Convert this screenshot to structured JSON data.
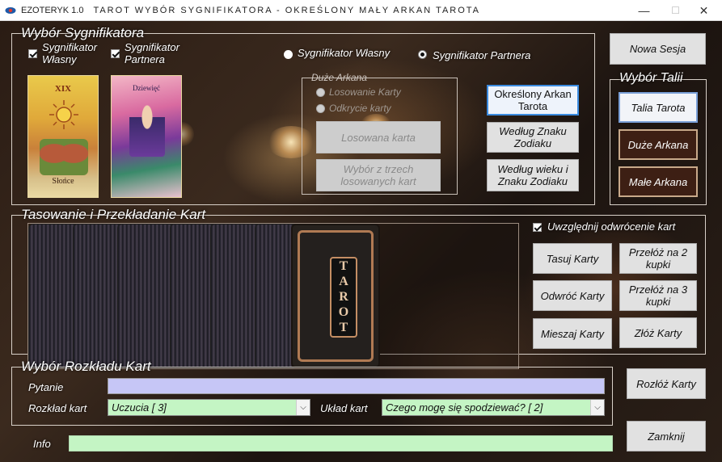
{
  "window": {
    "version": "EZOTERYK 1.0",
    "title": "TAROT   WYBÓR SYGNIFIKATORA - OKREŚLONY MAŁY ARKAN TAROTA",
    "minimize": "—",
    "maximize": "☐",
    "close": "✕"
  },
  "significator": {
    "group_title": "Wybór Sygnifikatora",
    "own_checkbox": "Sygnifikator Własny",
    "partner_checkbox": "Sygnifikator Partnera",
    "radio_own": "Sygnifikator Własny",
    "radio_partner": "Sygnifikator Partnera",
    "selected_radio": "partner",
    "card_own_numeral": "XIX",
    "card_own_caption": "Słońce",
    "card_partner_caption": "Dziewięć"
  },
  "major_arcana": {
    "group_title": "Duże Arkana",
    "radio_draw": "Losowanie Karty",
    "radio_pull": "Odkrycie karty",
    "random_card_button": "Losowana karta",
    "choose_three_button": "Wybór z trzech losowanych kart"
  },
  "significator_mode_buttons": {
    "specific_minor": "Określony Arkan Tarota",
    "by_zodiac": "Według Znaku Zodiaku",
    "by_age_zodiac": "Według wieku i Znaku Zodiaku"
  },
  "session": {
    "new_session_button": "Nowa Sesja"
  },
  "deck_choice": {
    "group_title": "Wybór Talii",
    "tarot_deck_button": "Talia Tarota",
    "major_button": "Duże Arkana",
    "minor_button": "Małe Arkana"
  },
  "shuffle": {
    "group_title": "Tasowanie i Przekładanie Kart",
    "reversed_checkbox": "Uwzględnij odwrócenie kart",
    "reversed_checked": true,
    "shuffle_button": "Tasuj Karty",
    "flip_button": "Odwróć Karty",
    "mix_button": "Mieszaj Karty",
    "cut2_button": "Przełóż na 2 kupki",
    "cut3_button": "Przełóż na 3 kupki",
    "fold_button": "Złóż Karty",
    "deck_card_label": "TAROT"
  },
  "spread": {
    "group_title": "Wybór Rozkładu Kart",
    "question_label": "Pytanie",
    "question_value": "",
    "spread_label": "Rozkład kart",
    "spread_value": "Uczucia [ 3]",
    "layout_label": "Układ kart",
    "layout_value": "Czego mogę się spodziewać? [ 2]",
    "dropdown_arrow": "⌵"
  },
  "actions": {
    "lay_out_button": "Rozłóż Karty",
    "close_button": "Zamknij"
  },
  "info": {
    "label": "Info",
    "value": ""
  },
  "colors": {
    "question_bg": "#c6c6f6",
    "combo_bg": "#c4f5c4",
    "info_bg": "#c4f5c4",
    "focus_border": "#3b8be0"
  }
}
